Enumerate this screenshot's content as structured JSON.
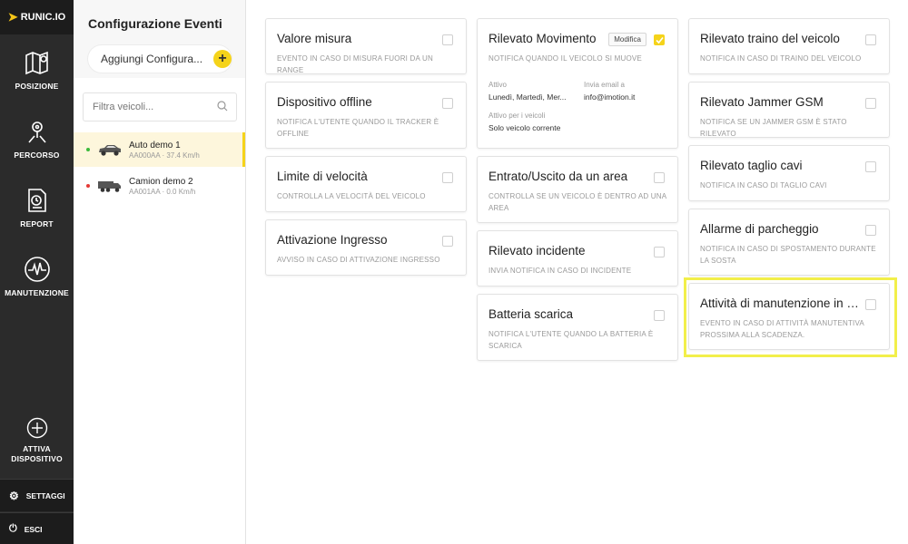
{
  "app": {
    "logo": "RUNIC.IO"
  },
  "nav": {
    "items": [
      {
        "label": "POSIZIONE",
        "icon": "map-icon"
      },
      {
        "label": "PERCORSO",
        "icon": "route-icon"
      },
      {
        "label": "REPORT",
        "icon": "report-icon"
      },
      {
        "label": "MANUTENZIONE",
        "icon": "heartbeat-icon"
      }
    ],
    "activate_line1": "ATTIVA",
    "activate_line2": "DISPOSITIVO",
    "settings": "SETTAGGI",
    "logout": "ESCI"
  },
  "panel": {
    "title": "Configurazione Eventi",
    "add_label": "Aggiungi Configura...",
    "add_icon": "+",
    "filter_placeholder": "Filtra veicoli...",
    "vehicles": [
      {
        "name": "Auto demo 1",
        "sub": "AA000AA · 37.4 Km/h",
        "status_color": "#3cba3c",
        "type": "car-icon"
      },
      {
        "name": "Camion demo 2",
        "sub": "AA001AA · 0.0 Km/h",
        "status_color": "#e53935",
        "type": "truck-icon"
      }
    ]
  },
  "cards": {
    "valore": {
      "title": "Valore misura",
      "desc": "EVENTO IN CASO DI MISURA FUORI DA UN RANGE"
    },
    "offline": {
      "title": "Dispositivo offline",
      "desc": "NOTIFICA L'UTENTE QUANDO IL TRACKER È OFFLINE"
    },
    "velocita": {
      "title": "Limite di velocità",
      "desc": "CONTROLLA LA VELOCITÀ DEL VEICOLO"
    },
    "ingresso": {
      "title": "Attivazione Ingresso",
      "desc": "AVVISO IN CASO DI ATTIVAZIONE INGRESSO"
    },
    "movimento": {
      "title": "Rilevato Movimento",
      "desc": "NOTIFICA QUANDO IL VEICOLO SI MUOVE",
      "modify": "Modifica",
      "active_label": "Attivo",
      "active_value": "Lunedì, Martedì, Mer...",
      "email_label": "Invia email a",
      "email_value": "info@imotion.it",
      "vehicles_label": "Attivo per i veicoli",
      "vehicles_value": "Solo veicolo corrente"
    },
    "area": {
      "title": "Entrato/Uscito da un area",
      "desc": "CONTROLLA SE UN VEICOLO È DENTRO AD UNA AREA"
    },
    "incidente": {
      "title": "Rilevato incidente",
      "desc": "INVIA NOTIFICA IN CASO DI INCIDENTE"
    },
    "batteria": {
      "title": "Batteria scarica",
      "desc": "NOTIFICA L'UTENTE QUANDO LA BATTERIA È SCARICA"
    },
    "traino": {
      "title": "Rilevato traino del veicolo",
      "desc": "NOTIFICA IN CASO DI TRAINO DEL VEICOLO"
    },
    "jammer": {
      "title": "Rilevato Jammer GSM",
      "desc": "NOTIFICA SE UN JAMMER GSM È STATO RILEVATO"
    },
    "cavi": {
      "title": "Rilevato taglio cavi",
      "desc": "NOTIFICA IN CASO DI TAGLIO CAVI"
    },
    "parcheggio": {
      "title": "Allarme di parcheggio",
      "desc": "NOTIFICA IN CASO DI SPOSTAMENTO DURANTE LA SOSTA"
    },
    "manutenzione": {
      "title": "Attività di manutenzione in s...",
      "desc": "EVENTO IN CASO DI ATTIVITÀ MANUTENTIVA PROSSIMA ALLA SCADENZA."
    }
  },
  "colors": {
    "accent": "#f5d31a",
    "nav_bg": "#2b2b2b",
    "highlight": "#f2ef4a"
  }
}
